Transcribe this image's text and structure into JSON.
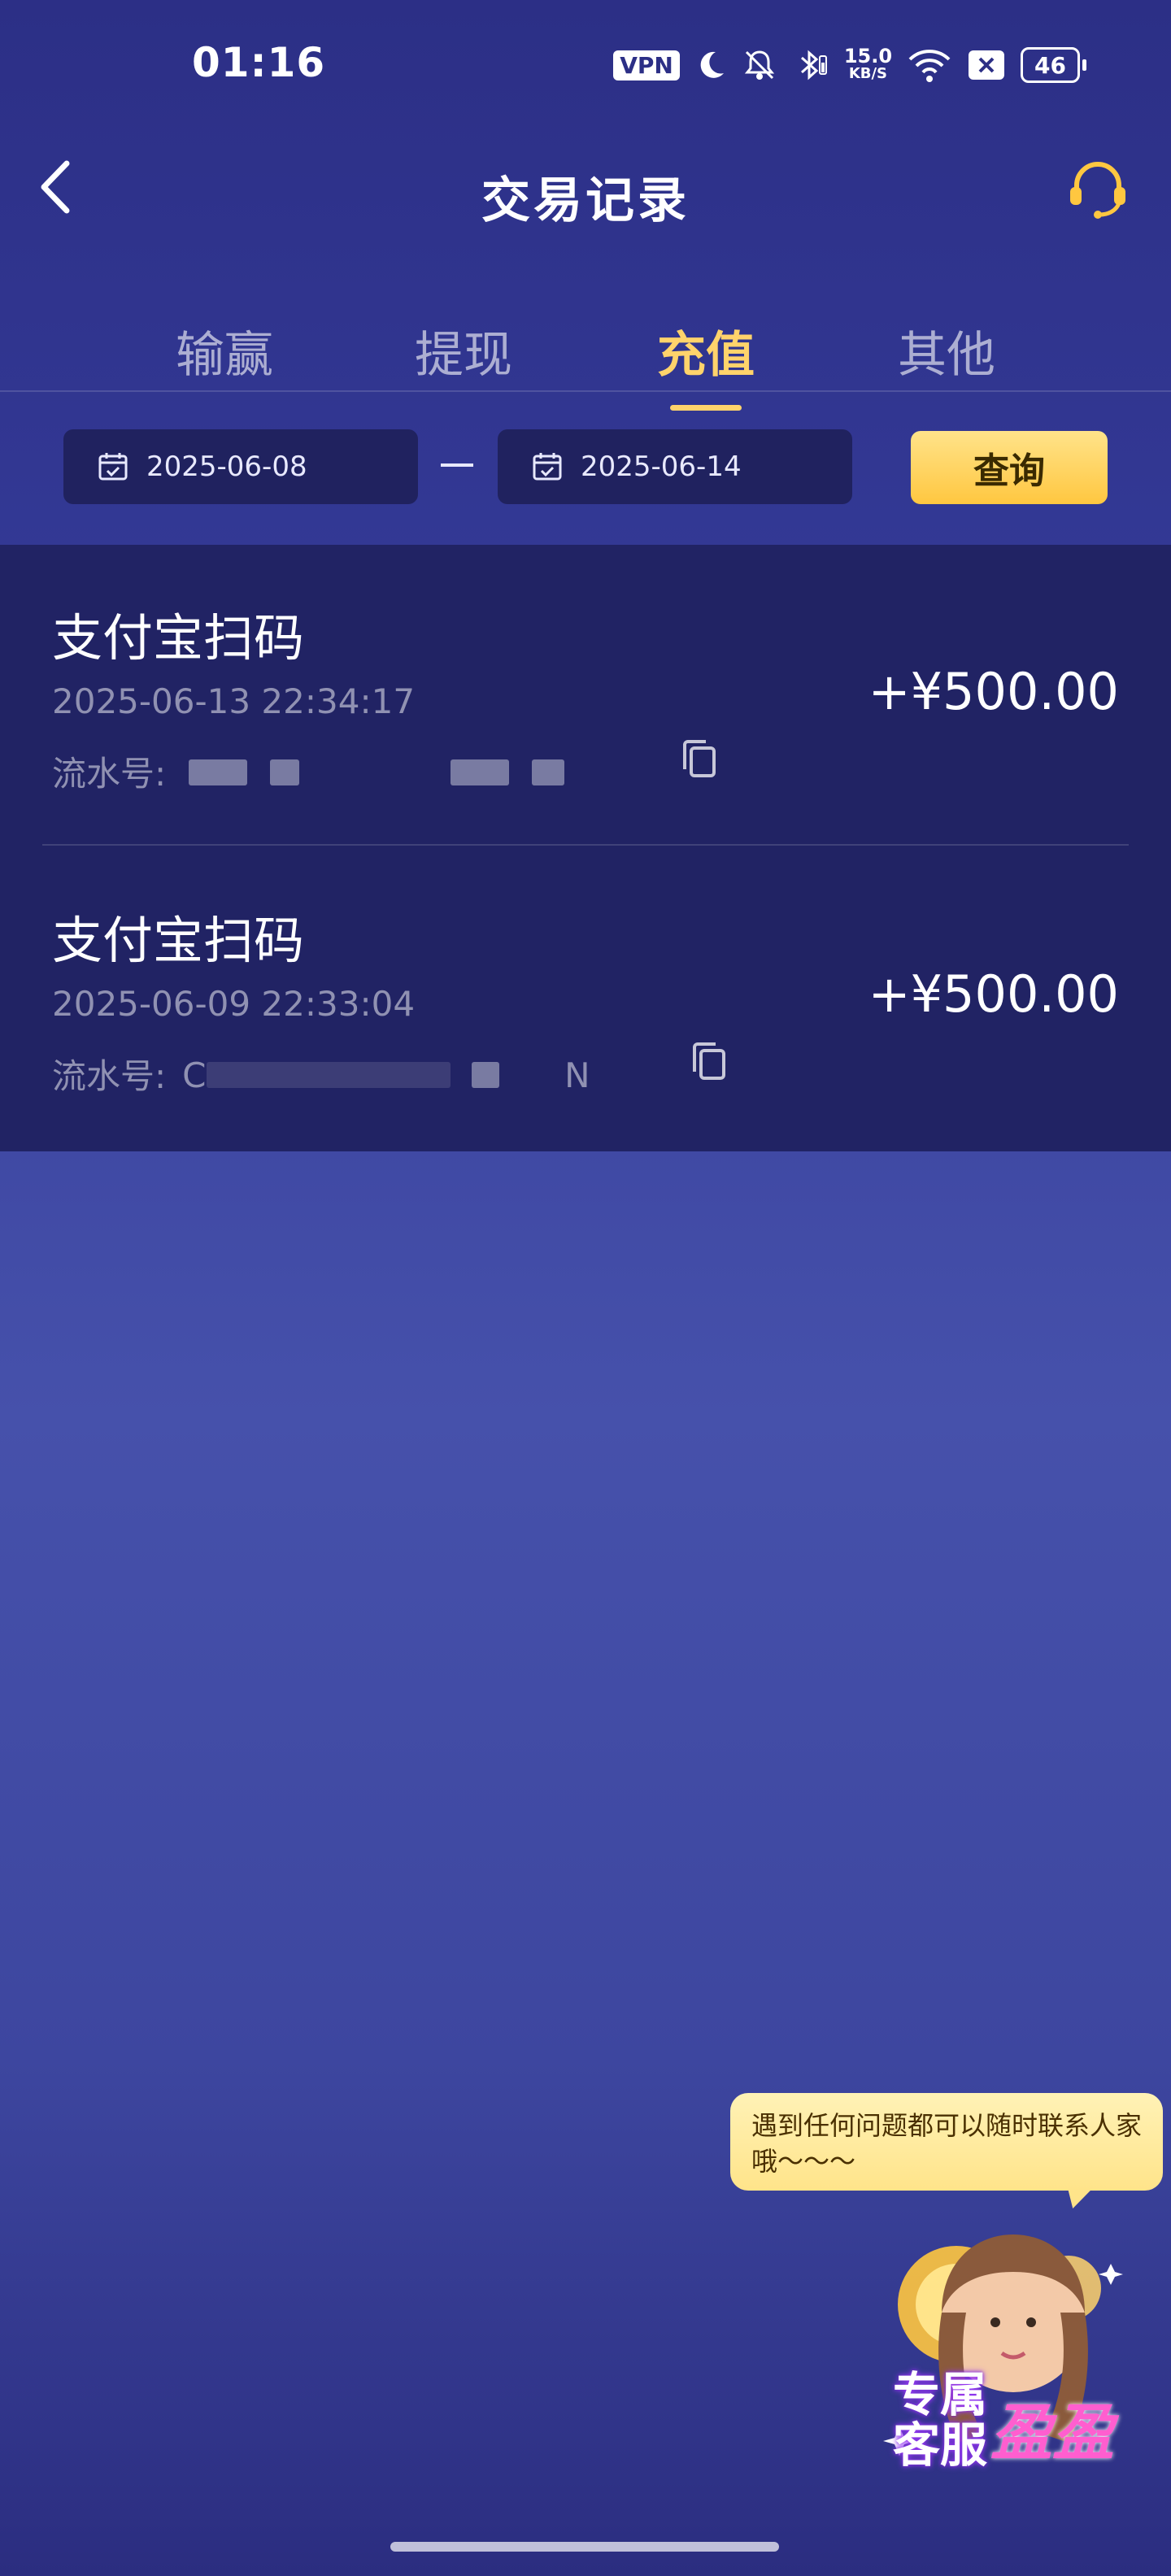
{
  "status_bar": {
    "time": "01:16",
    "vpn": "VPN",
    "net_speed_value": "15.0",
    "net_speed_unit": "KB/S",
    "battery": "46",
    "icons": [
      "moon-icon",
      "mute-icon",
      "bluetooth-icon",
      "wifi-icon",
      "sim-x-icon"
    ]
  },
  "header": {
    "title": "交易记录",
    "back_icon": "chevron-left-icon",
    "support_icon": "headset-icon"
  },
  "tabs": [
    {
      "label": "输赢",
      "active": false
    },
    {
      "label": "提现",
      "active": false
    },
    {
      "label": "充值",
      "active": true
    },
    {
      "label": "其他",
      "active": false
    }
  ],
  "filter": {
    "start_date": "2025-06-08",
    "end_date": "2025-06-14",
    "separator": "—",
    "query_label": "查询"
  },
  "records": [
    {
      "title": "支付宝扫码",
      "time": "2025-06-13 22:34:17",
      "serial_label": "流水号:",
      "amount": "+¥500.00"
    },
    {
      "title": "支付宝扫码",
      "time": "2025-06-09 22:33:04",
      "serial_label": "流水号:",
      "serial_visible_start": "C",
      "serial_visible_end": "N",
      "amount": "+¥500.00"
    }
  ],
  "support_bubble": {
    "text": "遇到任何问题都可以随时联系人家哦～～～"
  },
  "mascot": {
    "label_line1": "专属",
    "label_line2": "客服",
    "name": "盈盈"
  },
  "colors": {
    "accent": "#ffd36b",
    "list_bg": "#212364",
    "page_bg": "#3a43a0",
    "query_button": "#ffc740"
  }
}
